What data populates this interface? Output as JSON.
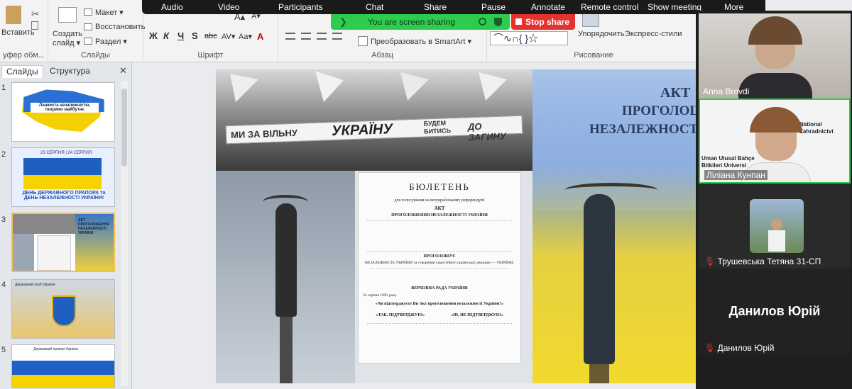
{
  "zoom_toolbar": {
    "items": [
      "Audio",
      "Video",
      "Participants",
      "Chat",
      "Share",
      "Pause",
      "Annotate",
      "Remote control",
      "Show meeting",
      "More"
    ],
    "sharing_status": "You are screen sharing",
    "stop_share": "Stop share"
  },
  "ribbon": {
    "clipboard": {
      "paste": "Вставить",
      "label": "уфер обм..."
    },
    "slides": {
      "new_slide": "Создать слайд ▾",
      "layout": "Макет ▾",
      "reset": "Восстановить",
      "section": "Раздел ▾",
      "label": "Слайды"
    },
    "font": {
      "bold": "Ж",
      "italic": "К",
      "underline": "Ч",
      "strike": "S",
      "abc": "abc",
      "spacing": "AV▾",
      "case": "Aa▾",
      "grow": "A▴",
      "shrink": "A▾",
      "label": "Шрифт"
    },
    "paragraph": {
      "smartart": "Преобразовать в SmartArt ▾",
      "label": "Абзац"
    },
    "drawing": {
      "arrange": "Упорядочить",
      "quick_styles": "Экспресс-стили",
      "label": "Рисование"
    }
  },
  "slides_panel": {
    "tabs": [
      "Слайды",
      "Структура"
    ],
    "close": "✕",
    "thumbnails": [
      {
        "num": "1",
        "text": "Ланкиста незалежністю, творимо майбутнє"
      },
      {
        "num": "2",
        "text": "ДЕНЬ ДЕРЖАВНОГО ПРАПОРА та ДЕНЬ НЕЗАЛЕЖНОСТІ УКРАЇНИ!",
        "dates": "23 СЕРПНЯ | 24 СЕРПНЯ"
      },
      {
        "num": "3",
        "text": "АКТ ПРОГОЛОШЕННЯ НЕЗАЛЕЖНОСТІ УКРАЇНИ"
      },
      {
        "num": "4",
        "text": "Державний герб України"
      },
      {
        "num": "5",
        "text": "Державний прапор України"
      }
    ]
  },
  "slide": {
    "banner_words": [
      "МИ ЗА ВІЛЬНУ",
      "УКРАЇНУ",
      "БУДЕМ БИТИСЬ",
      "ДО ЗАГИНУ"
    ],
    "ballot": {
      "title": "БЮЛЕТЕНЬ",
      "subtitle": "для голосування на всеукраїнському референдумі",
      "act": "АКТ",
      "act_title": "ПРОГОЛОШЕННЯ НЕЗАЛЕЖНОСТІ УКРАЇНИ",
      "proclaim": "ПРОГОЛОШУЄ",
      "independence": "НЕЗАЛЕЖНІСТЬ УКРАЇНИ та створення самостійної української держави — УКРАЇНИ.",
      "rada": "ВЕРХОВНА РАДА УКРАЇНИ",
      "date": "24 серпня 1991 року",
      "question": "«Чи підтверджуєте Ви Акт проголошення незалежності України?»",
      "yes": "«ТАК, ПІДТВЕРДЖУЮ»",
      "no": "«НІ, НЕ ПІДТВЕРДЖУЮ»"
    },
    "act_text": [
      "АКТ",
      "ПРОГОЛОШЕ",
      "НЕЗАЛЕЖНОСТІ У"
    ]
  },
  "participants": [
    {
      "name": "Anna  Brovdi",
      "muted": false
    },
    {
      "name": "Ліліана Кунпан",
      "muted": false,
      "active": true,
      "bg_text": [
        "Uman Ulusal Bahçe",
        "Bitkileri Universi"
      ],
      "bg_text2": [
        "National",
        "Zahradnictví"
      ]
    },
    {
      "name": "Трушевська Тетяна 31-СП",
      "muted": true
    },
    {
      "name": "Данилов Юрій",
      "muted": true,
      "display_name": "Данилов Юрій"
    }
  ]
}
